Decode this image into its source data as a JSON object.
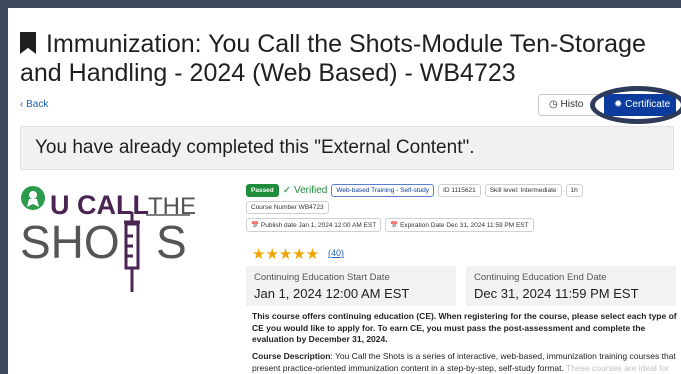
{
  "header": {
    "title": "Immunization: You Call the Shots-Module Ten-Storage and Handling - 2024 (Web Based) - WB4723",
    "back_label": "Back"
  },
  "buttons": {
    "history": "Histo",
    "certificate": "Certificate"
  },
  "banner": {
    "text": "You have already completed this \"External Content\"."
  },
  "logo": {
    "line1": "U CALL",
    "line1b": "THE",
    "line2a": "SHO",
    "line2b": "S"
  },
  "badges": {
    "passed": "Passed",
    "verified": "Verified",
    "type": "Web-based Training - Self-study",
    "id": "ID 1115621",
    "skill": "Skill level: Intermediate",
    "duration": "1h",
    "course_number": "Course Number WB4723",
    "publish_date": "Publish date Jan 1, 2024 12:00 AM EST",
    "expiration_date": "Expiration Date Dec 31, 2024 11:59 PM EST"
  },
  "rating": {
    "stars": "★★★★★",
    "reviews": "(40)",
    "value": 4.5
  },
  "ce": {
    "start_label": "Continuing Education Start Date",
    "start_value": "Jan 1, 2024 12:00 AM EST",
    "end_label": "Continuing Education End Date",
    "end_value": "Dec 31, 2024 11:59 PM EST"
  },
  "description": {
    "ce_notice": "This course offers continuing education (CE). When registering for the course, please select each type of CE you would like to apply for. To earn CE, you must pass the post-assessment and complete the evaluation by December 31, 2024.",
    "course_label": "Course Description",
    "course_text": ": You Call the Shots is a series of interactive, web-based, immunization training courses that present practice-oriented immunization content in a step-by-step, self-study format.",
    "course_faded": "These courses are ideal for medical or nursing students, new vaccination providers, or seasoned"
  },
  "colors": {
    "accent": "#0b3b9c",
    "passed": "#1e8c3a",
    "stars": "#f0a400",
    "logo_green": "#2d9b4c",
    "logo_purple": "#4a2453"
  }
}
